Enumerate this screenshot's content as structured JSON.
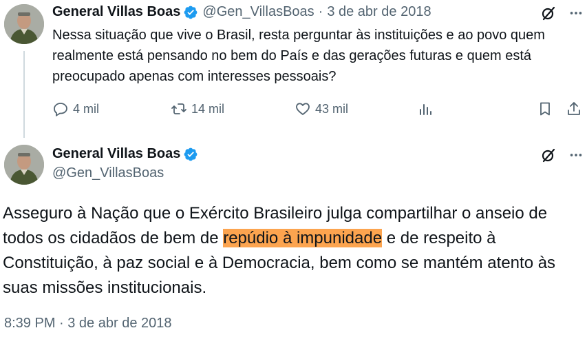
{
  "reply_tweet": {
    "author_name": "General Villas Boas",
    "handle": "@Gen_VillasBoas",
    "separator": "·",
    "date": "3 de abr de 2018",
    "text": "Nessa situação que vive o Brasil, resta perguntar às instituições e ao povo quem realmente está pensando no bem do País e das gerações futuras e quem está preocupado apenas com interesses pessoais?",
    "stats": {
      "replies": "4 mil",
      "retweets": "14 mil",
      "likes": "43 mil"
    }
  },
  "main_tweet": {
    "author_name": "General Villas Boas",
    "handle": "@Gen_VillasBoas",
    "text_before": "Asseguro à Nação que o Exército Brasileiro julga compartilhar o anseio de todos os cidadãos de bem de ",
    "text_highlight": "repúdio à impunidade",
    "text_after": " e de respeito à Constituição, à paz social e à Democracia, bem como se mantém atento às suas missões institucionais.",
    "timestamp": "8:39 PM · 3 de abr de 2018"
  },
  "colors": {
    "verified": "#1d9bf0",
    "muted": "#536471",
    "highlight": "#fca44f"
  }
}
